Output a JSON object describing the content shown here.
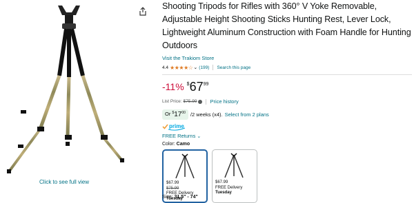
{
  "image": {
    "see_full_view": "Click to see full view"
  },
  "product": {
    "title": "Shooting Tripods for Rifles with 360° V Yoke Removable, Adjustable Height Shooting Sticks Hunting Rest, Lever Lock, Lightweight Aluminum Construction with Foam Handle for Hunting Outdoors",
    "store_link": "Visit the Trakiom Store",
    "rating_value": "4.4",
    "stars": "★★★★☆",
    "rating_count": "(199)",
    "search_page": "Search this page"
  },
  "price": {
    "discount": "-11%",
    "currency": "$",
    "whole": "67",
    "fraction": "99",
    "list_price_label": "List Price:",
    "list_price": "$75.99",
    "price_history": "Price history"
  },
  "plan": {
    "or_label": "Or",
    "currency": "$",
    "amount": "17",
    "cents": "00",
    "terms": "/2 weeks (x4).",
    "link": "Select from 2 plans"
  },
  "prime_label": "prime",
  "free_returns": "FREE Returns",
  "color": {
    "label": "Color:",
    "value": "Camo"
  },
  "swatches": [
    {
      "price": "$67.99",
      "old_price": "$75.99",
      "delivery": "FREE Delivery",
      "day": "Tuesday"
    },
    {
      "price": "$67.99",
      "delivery": "FREE Delivery",
      "day": "Tuesday"
    }
  ],
  "size": {
    "label": "Size:",
    "value": "31.5\" - 74\""
  },
  "colors": {
    "link": "#007185",
    "discount": "#cc0c39",
    "star": "#de7921",
    "prime_blue": "#00a8e1",
    "selected_border": "#2162a1"
  }
}
